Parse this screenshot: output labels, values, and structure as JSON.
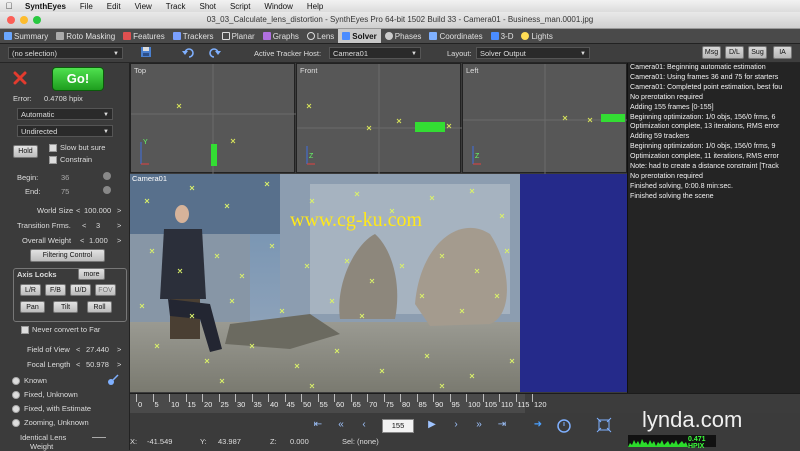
{
  "menubar": {
    "app": "SynthEyes",
    "items": [
      "File",
      "Edit",
      "View",
      "Track",
      "Shot",
      "Script",
      "Window",
      "Help"
    ]
  },
  "window": {
    "title": "03_03_Calculate_lens_distortion - SynthEyes Pro 64-bit 1502 Build 33 - Camera01 - Business_man.0001.jpg"
  },
  "tabs": [
    {
      "label": "Summary",
      "color": "#6aa7ff"
    },
    {
      "label": "Roto Masking",
      "color": "#aaaaaa"
    },
    {
      "label": "Features",
      "color": "#e05050"
    },
    {
      "label": "Trackers",
      "color": "#7aa0ff"
    },
    {
      "label": "Planar",
      "color": "#dddddd"
    },
    {
      "label": "Graphs",
      "color": "#b070e0"
    },
    {
      "label": "Lens",
      "color": "#dddddd"
    },
    {
      "label": "Solver",
      "color": "#4a8cff"
    },
    {
      "label": "Phases",
      "color": "#cccccc"
    },
    {
      "label": "Coordinates",
      "color": "#7fb0ff"
    },
    {
      "label": "3-D",
      "color": "#4a8cff"
    },
    {
      "label": "Lights",
      "color": "#ffdd55"
    }
  ],
  "active_tab": "Solver",
  "toolbar": {
    "selection": "(no selection)",
    "active_tracker_host_label": "Active Tracker Host:",
    "active_tracker_host": "Camera01",
    "layout_label": "Layout:",
    "layout": "Solver Output",
    "buttons": [
      "Msg",
      "D/L",
      "Sug",
      "IA"
    ]
  },
  "solver": {
    "go_label": "Go!",
    "error_label": "Error:",
    "error_value": "0.4708 hpix",
    "mode": "Automatic",
    "direction": "Undirected",
    "hold_label": "Hold",
    "slow_but_sure": "Slow but sure",
    "constrain": "Constrain",
    "begin_label": "Begin:",
    "begin_value": "36",
    "end_label": "End:",
    "end_value": "75",
    "world_size_label": "World Size",
    "world_size": "100.000",
    "transition_label": "Transition Frms.",
    "transition": "3",
    "overall_weight_label": "Overall Weight",
    "overall_weight": "1.000",
    "filtering_control": "Filtering Control",
    "axis_locks_label": "Axis Locks",
    "more_label": "more",
    "axis_buttons": [
      "L/R",
      "F/B",
      "U/D",
      "FOV",
      "Pan",
      "Tilt",
      "Roll"
    ],
    "never_convert": "Never convert to Far",
    "field_of_view_label": "Field of View",
    "field_of_view": "27.440",
    "focal_length_label": "Focal Length",
    "focal_length": "50.978",
    "lens_modes": [
      "Known",
      "Fixed, Unknown",
      "Fixed, with Estimate",
      "Zooming, Unknown"
    ],
    "identical_lens_label": "Identical Lens",
    "weight_label": "Weight"
  },
  "viewports": [
    {
      "name": "Top"
    },
    {
      "name": "Front"
    },
    {
      "name": "Left"
    }
  ],
  "camera_view": {
    "name": "Camera01",
    "watermark": "www.cg-ku.com"
  },
  "log": [
    "Camera01: Beginning automatic estimation",
    "Camera01: Using frames 36 and 75 for starters",
    "Camera01: Completed point estimation, best fou",
    "No prerotation required",
    "Adding 155 frames [0-155]",
    "Beginning optimization: 1/0 objs, 156/0 frms, 6",
    "Optimization complete, 13 iterations, RMS error",
    "Adding 59 trackers",
    "Beginning optimization: 1/0 objs, 156/0 frms, 9",
    "Optimization complete, 11 iterations, RMS error",
    "Note: had to create a distance constraint [Track",
    "No prerotation required",
    "Finished solving, 0:00.8 min:sec.",
    "Finished solving the scene"
  ],
  "timeline": {
    "ticks": [
      "0",
      "5",
      "10",
      "15",
      "20",
      "25",
      "30",
      "35",
      "40",
      "45",
      "50",
      "55",
      "60",
      "65",
      "70",
      "75",
      "80",
      "85",
      "90",
      "95",
      "100",
      "105",
      "110",
      "115",
      "120"
    ],
    "current_frame": "155"
  },
  "statusbar": {
    "x_label": "X:",
    "x": "-41.549",
    "y_label": "Y:",
    "y": "43.987",
    "z_label": "Z:",
    "z": "0.000",
    "sel": "Sel: (none)",
    "hpix": "0.471 HPIX",
    "brand": "lynda.com"
  }
}
